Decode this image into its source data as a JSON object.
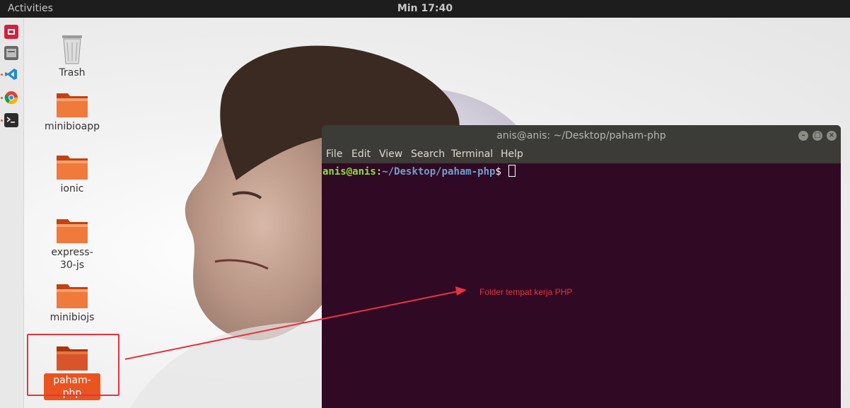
{
  "topbar": {
    "activities": "Activities",
    "clock": "Min 17:40"
  },
  "dock": {
    "items": [
      {
        "name": "software-center",
        "color": "#d6203b"
      },
      {
        "name": "file-manager",
        "color": "#5b5b5b"
      },
      {
        "name": "vscode",
        "color": "#1f8ad2"
      },
      {
        "name": "chrome",
        "color": "#db4437"
      },
      {
        "name": "terminal",
        "color": "#2c2c2c"
      }
    ]
  },
  "desktop": {
    "icons": [
      {
        "label": "Trash"
      },
      {
        "label": "minibioapp"
      },
      {
        "label": "ionic"
      },
      {
        "label": "express-30-js"
      },
      {
        "label": "minibiojs"
      },
      {
        "label": "paham-php",
        "selected": true
      }
    ]
  },
  "terminal": {
    "title": "anis@anis: ~/Desktop/paham-php",
    "menu": [
      "File",
      "Edit",
      "View",
      "Search",
      "Terminal",
      "Help"
    ],
    "prompt_user": "anis@anis",
    "prompt_path": "~/Desktop/paham-php",
    "prompt_symbol": "$"
  },
  "annotation": {
    "text": "Folder tempat kerja PHP",
    "color": "#e8323f"
  }
}
